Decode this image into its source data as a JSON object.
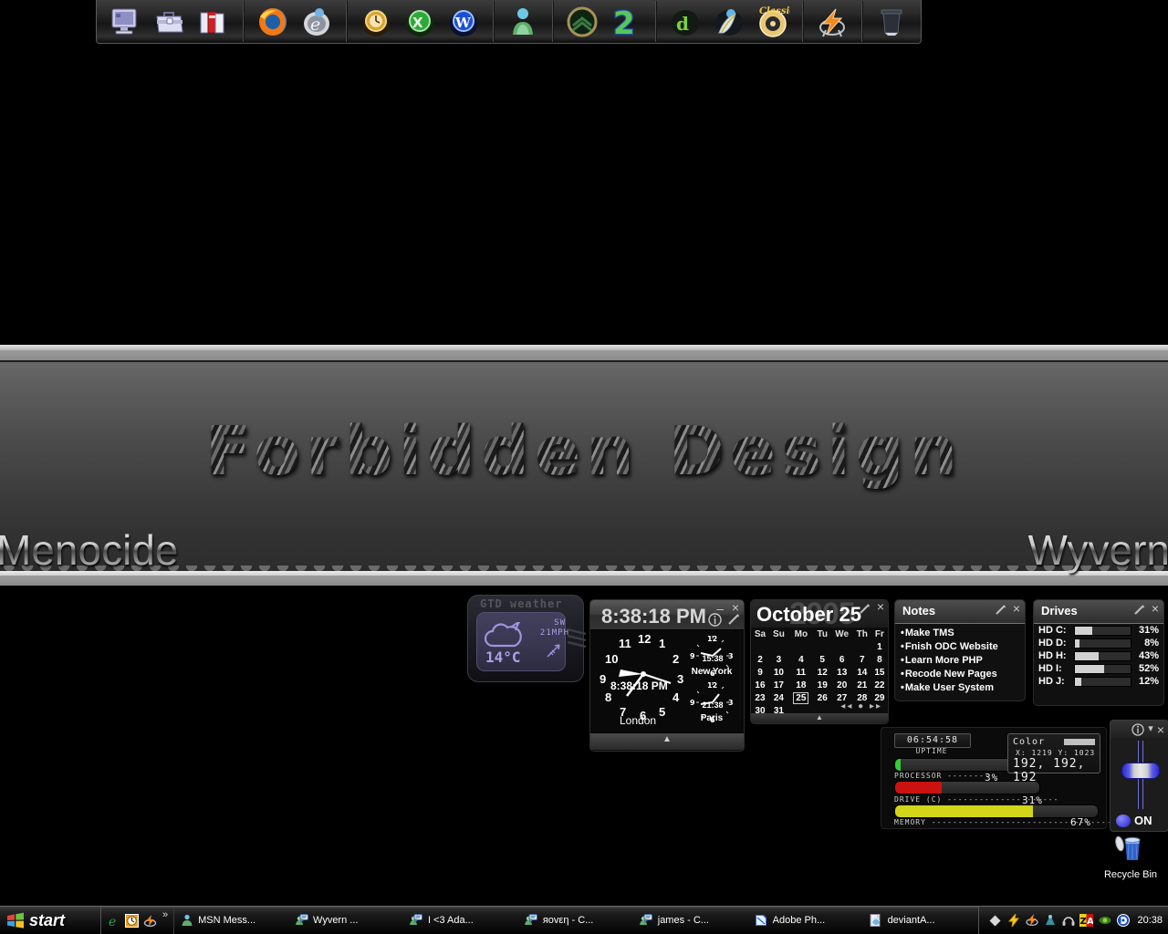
{
  "desktop": {
    "wallpaper": {
      "title": "Forbidden Design",
      "left_text": "Menocide",
      "right_text": "Wyvern"
    },
    "recycle_bin": {
      "label": "Recycle Bin"
    }
  },
  "dock": {
    "groups": [
      {
        "name": "files",
        "items": [
          {
            "icon": "my-computer-icon",
            "label": "My Computer"
          },
          {
            "icon": "my-documents-icon",
            "label": "My Documents"
          },
          {
            "icon": "folders-icon",
            "label": "Folders"
          }
        ]
      },
      {
        "name": "browsers",
        "items": [
          {
            "icon": "firefox-icon",
            "label": "Firefox"
          },
          {
            "icon": "internet-explorer-icon",
            "label": "Internet Explorer"
          }
        ]
      },
      {
        "name": "office",
        "items": [
          {
            "icon": "clock-orb-icon",
            "label": "Clock"
          },
          {
            "icon": "excel-orb-icon",
            "label": "Excel"
          },
          {
            "icon": "word-orb-icon",
            "label": "Word"
          }
        ]
      },
      {
        "name": "messenger",
        "items": [
          {
            "icon": "msn-messenger-icon",
            "label": "MSN Messenger"
          }
        ]
      },
      {
        "name": "games",
        "items": [
          {
            "icon": "citroen-badge-icon",
            "label": "Game"
          },
          {
            "icon": "number-two-icon",
            "label": "2"
          }
        ]
      },
      {
        "name": "media",
        "items": [
          {
            "icon": "dreamweaver-orb-icon",
            "label": "Dreamweaver"
          },
          {
            "icon": "feather-orb-icon",
            "label": "Media"
          },
          {
            "icon": "classic-cd-icon",
            "label": "Classic"
          }
        ]
      },
      {
        "name": "utilities",
        "items": [
          {
            "icon": "winamp-lightning-icon",
            "label": "Winamp"
          }
        ]
      },
      {
        "name": "trash",
        "items": [
          {
            "icon": "trash-bin-icon",
            "label": "Trash"
          }
        ]
      }
    ]
  },
  "weather": {
    "title": "GTD weather",
    "temperature": "14°C",
    "wind_dir": "SW",
    "wind_speed": "21MPH",
    "condition_icon": "cloud-icon"
  },
  "clock": {
    "time": "8:38:18 PM",
    "main_city": "London",
    "hour_numbers": [
      "11",
      "12",
      "1",
      "10",
      "2",
      "9",
      "3",
      "8",
      "4",
      "7",
      "6",
      "5"
    ],
    "zones": [
      {
        "city": "New York",
        "time": "15:38"
      },
      {
        "city": "Paris",
        "time": "21:38"
      }
    ],
    "controls": {
      "minimize": "–",
      "close": "×",
      "info": "i",
      "resize": "resize-icon"
    }
  },
  "calendar": {
    "month_day": "October 25",
    "year_watermark": "2005",
    "weekday_headers": [
      "Sa",
      "Su",
      "Mo",
      "Tu",
      "We",
      "Th",
      "Fr"
    ],
    "weeks": [
      [
        "",
        "",
        "",
        "",
        "",
        "",
        "1"
      ],
      [
        "2",
        "3",
        "4",
        "5",
        "6",
        "7",
        "8"
      ],
      [
        "9",
        "10",
        "11",
        "12",
        "13",
        "14",
        "15"
      ],
      [
        "16",
        "17",
        "18",
        "19",
        "20",
        "21",
        "22"
      ],
      [
        "23",
        "24",
        "25",
        "26",
        "27",
        "28",
        "29"
      ],
      [
        "30",
        "31",
        "",
        "",
        "",
        "",
        ""
      ]
    ],
    "selected_day": "25",
    "nav": {
      "prev": "◂◂",
      "today": "●",
      "next": "▸▸"
    }
  },
  "notes": {
    "title": "Notes",
    "items": [
      "Make TMS",
      "Fnish ODC Website",
      "Learn More PHP",
      "Recode New Pages",
      "Make User System"
    ]
  },
  "drives": {
    "title": "Drives",
    "rows": [
      {
        "name": "HD C:",
        "percent": 31,
        "percent_label": "31%"
      },
      {
        "name": "HD D:",
        "percent": 8,
        "percent_label": "8%"
      },
      {
        "name": "HD H:",
        "percent": 43,
        "percent_label": "43%"
      },
      {
        "name": "HD I:",
        "percent": 52,
        "percent_label": "52%"
      },
      {
        "name": "HD J:",
        "percent": 12,
        "percent_label": "12%"
      }
    ]
  },
  "sysmon": {
    "uptime_value": "06:54:58",
    "uptime_label": "UPTIME",
    "uptime_percent": 4,
    "uptime_color": "#33cc33",
    "processor_label": "PROCESSOR --------",
    "processor_value": "3%",
    "processor_percent": 32,
    "processor_color": "#cc1111",
    "drive_label": "DRIVE (C) ---------------------",
    "drive_value": "31%",
    "drive_percent": 68,
    "drive_color": "#d4d41a",
    "memory_label": "MEMORY ----------------------------------",
    "memory_value": "67%",
    "color_panel": {
      "label": "Color",
      "swatch": "#c0c0c0",
      "coords": "X: 1219   Y: 1023",
      "rgb": "192, 192, 192"
    }
  },
  "volume": {
    "state_label": "ON",
    "level": 62
  },
  "taskbar": {
    "start_label": "start",
    "quicklaunch": [
      {
        "icon": "internet-explorer-icon"
      },
      {
        "icon": "clock-icon"
      },
      {
        "icon": "winamp-icon"
      }
    ],
    "quicklaunch_more": "»",
    "tasks": [
      {
        "icon": "msn-messenger-icon",
        "label": "MSN Mess..."
      },
      {
        "icon": "msn-chat-icon",
        "label": "Wyvern  ..."
      },
      {
        "icon": "msn-chat-icon",
        "label": "I <3 Ada..."
      },
      {
        "icon": "msn-chat-icon",
        "label": "яovεη - C..."
      },
      {
        "icon": "msn-chat-icon",
        "label": "james - C..."
      },
      {
        "icon": "photoshop-icon",
        "label": "Adobe Ph..."
      },
      {
        "icon": "deviantart-icon",
        "label": "deviantA..."
      }
    ],
    "tray": {
      "icons": [
        "diamond-icon",
        "lightning-icon",
        "winamp-icon",
        "samurize-icon",
        "headphones-icon",
        "zonealarm-icon",
        "nvidia-icon",
        "daemon-tools-icon"
      ],
      "clock": "20:38"
    }
  }
}
